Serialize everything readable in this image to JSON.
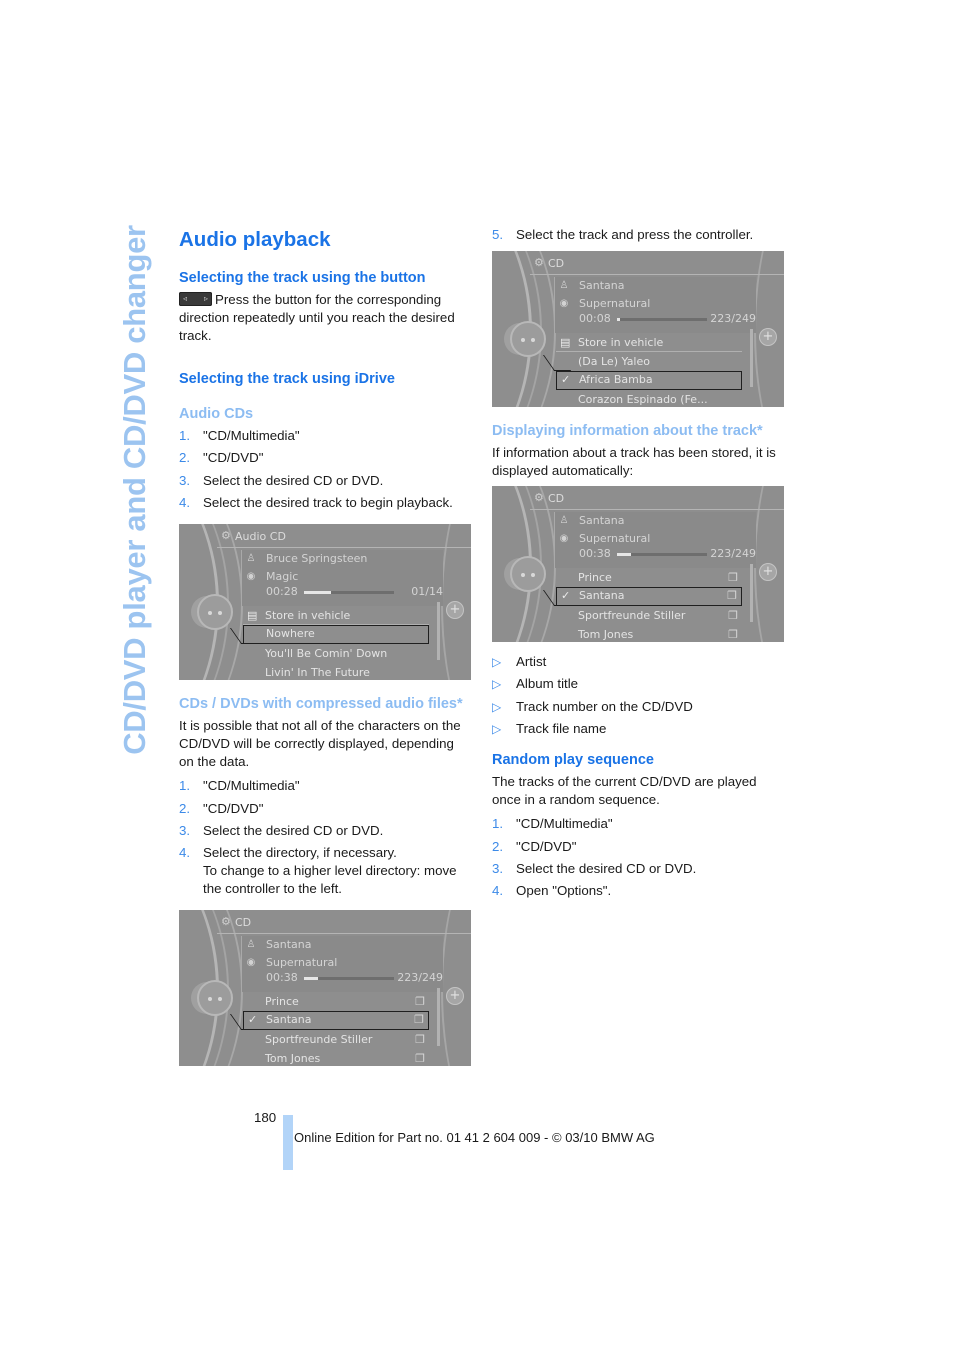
{
  "side_title": "CD/DVD player and CD/DVD changer",
  "left": {
    "title": "Audio playback",
    "section1": {
      "heading": "Selecting the track using the button",
      "button_icon": "skip-buttons-icon",
      "text": "Press the button for the corresponding direction repeatedly until you reach the desired track."
    },
    "section2": {
      "heading": "Selecting the track using iDrive"
    },
    "audio_cds": {
      "heading": "Audio CDs",
      "steps": [
        {
          "n": "1.",
          "t": "\"CD/Multimedia\""
        },
        {
          "n": "2.",
          "t": "\"CD/DVD\""
        },
        {
          "n": "3.",
          "t": "Select the desired CD or DVD."
        },
        {
          "n": "4.",
          "t": "Select the desired track to begin playback."
        }
      ],
      "screen": {
        "header": "Audio CD",
        "artist": "Bruce Springsteen",
        "album": "Magic",
        "time": "00:28",
        "count": "01/14",
        "progress": 0.3,
        "rows": [
          {
            "label": "Store in vehicle",
            "icon": "save-icon"
          },
          {
            "label": "Nowhere",
            "selected": true
          },
          {
            "label": "You'll Be Comin' Down"
          },
          {
            "label": "Livin' In The Future"
          }
        ]
      }
    },
    "compressed": {
      "heading": "CDs / DVDs with compressed audio files*",
      "text": "It is possible that not all of the characters on the CD/DVD will be correctly displayed, depending on the data.",
      "steps": [
        {
          "n": "1.",
          "t": "\"CD/Multimedia\""
        },
        {
          "n": "2.",
          "t": "\"CD/DVD\""
        },
        {
          "n": "3.",
          "t": "Select the desired CD or DVD."
        },
        {
          "n": "4.",
          "t": "Select the directory, if necessary.",
          "t2": "To change to a higher level directory: move the controller to the left."
        }
      ],
      "screen": {
        "header": "CD",
        "artist": "Santana",
        "album": "Supernatural",
        "time": "00:38",
        "count": "223/249",
        "progress": 0.15,
        "rows": [
          {
            "label": "Prince"
          },
          {
            "label": "Santana",
            "selected": true,
            "checked": true
          },
          {
            "label": "Sportfreunde Stiller"
          },
          {
            "label": "Tom Jones"
          }
        ]
      }
    }
  },
  "right": {
    "step5": {
      "n": "5.",
      "t": "Select the track and press the controller."
    },
    "screen1": {
      "header": "CD",
      "artist": "Santana",
      "album": "Supernatural",
      "time": "00:08",
      "count": "223/249",
      "progress": 0.03,
      "rows": [
        {
          "label": "Store in vehicle",
          "icon": "save-icon"
        },
        {
          "label": "(Da Le) Yaleo"
        },
        {
          "label": "Africa Bamba",
          "selected": true,
          "checked": true
        },
        {
          "label": "Corazon Espinado (Fe..."
        }
      ]
    },
    "display_info": {
      "heading": "Displaying information about the track*",
      "text": "If information about a track has been stored, it is displayed automatically:"
    },
    "screen2": {
      "header": "CD",
      "artist": "Santana",
      "album": "Supernatural",
      "time": "00:38",
      "count": "223/249",
      "progress": 0.15,
      "rows": [
        {
          "label": "Prince"
        },
        {
          "label": "Santana",
          "selected": true,
          "checked": true
        },
        {
          "label": "Sportfreunde Stiller"
        },
        {
          "label": "Tom Jones"
        }
      ]
    },
    "bullets": [
      "Artist",
      "Album title",
      "Track number on the CD/DVD",
      "Track file name"
    ],
    "random": {
      "heading": "Random play sequence",
      "text": "The tracks of the current CD/DVD are played once in a random sequence.",
      "steps": [
        {
          "n": "1.",
          "t": "\"CD/Multimedia\""
        },
        {
          "n": "2.",
          "t": "\"CD/DVD\""
        },
        {
          "n": "3.",
          "t": "Select the desired CD or DVD."
        },
        {
          "n": "4.",
          "t": "Open \"Options\"."
        }
      ]
    }
  },
  "footer": {
    "page_number": "180",
    "edition": "Online Edition for Part no. 01 41 2 604 009 - © 03/10 BMW AG"
  },
  "colors": {
    "heading_blue": "#1a73e6",
    "light_blue": "#8cbcf2",
    "side_title": "#9cc4f0",
    "footer_bar": "#b2d4f8"
  }
}
